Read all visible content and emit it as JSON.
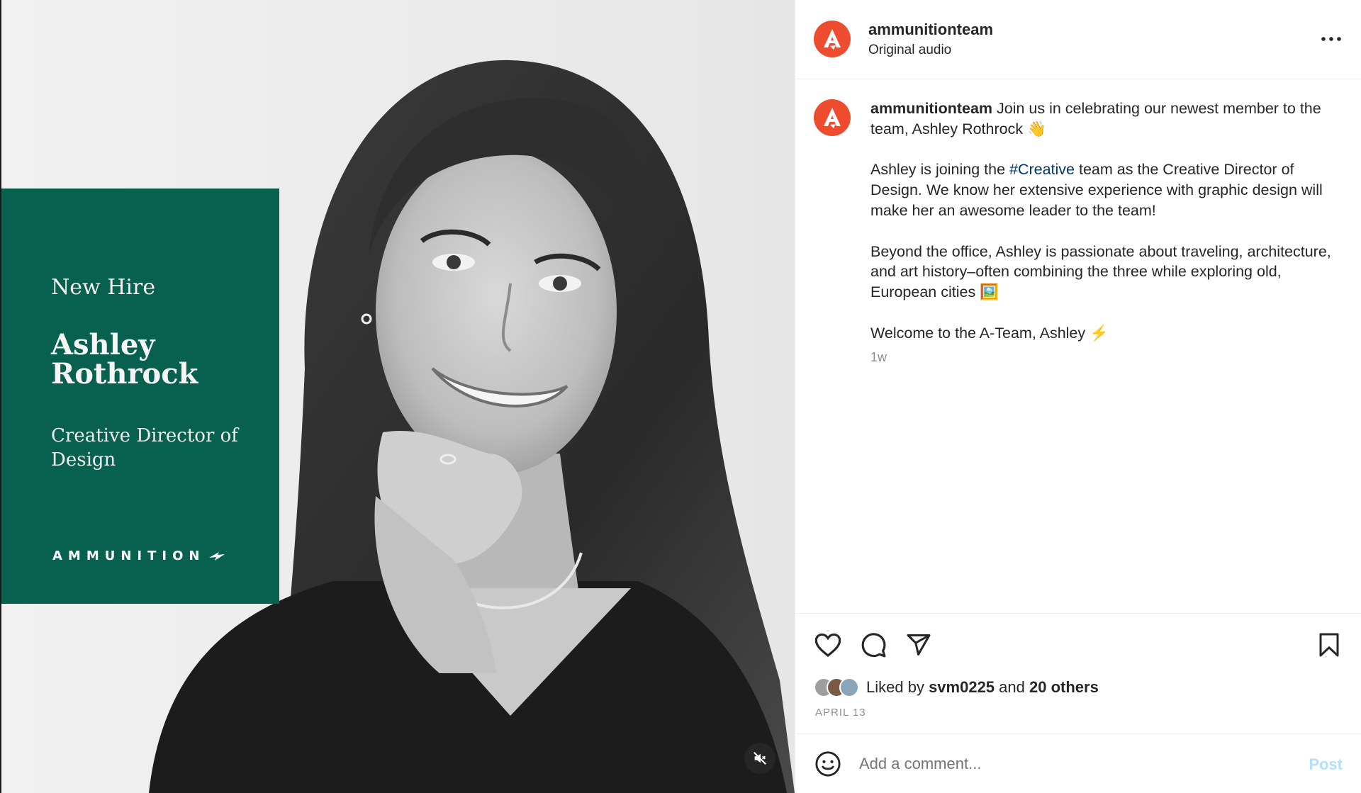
{
  "media": {
    "card": {
      "eyebrow": "New Hire",
      "name": "Ashley Rothrock",
      "role": "Creative Director of Design",
      "brand": "AMMUNITION"
    },
    "mute_icon": "speaker-muted-icon",
    "card_color": "#08614f"
  },
  "header": {
    "username": "ammunitionteam",
    "subtitle": "Original audio",
    "avatar_color": "#ee4c2e",
    "more_icon": "more-horizontal-icon"
  },
  "caption": {
    "username": "ammunitionteam",
    "line1_text": " Join us in celebrating our newest member to the team, Ashley Rothrock 👋",
    "p2_before": "Ashley is joining the ",
    "p2_hashtag": "#Creative",
    "p2_after": " team as the Creative Director of Design. We know her extensive experience with graphic design will make her an awesome leader to the team!",
    "p3": "Beyond the office, Ashley is passionate about traveling, architecture, and art history–often combining the three while exploring old, European cities 🖼️",
    "p4": "Welcome to the A-Team, Ashley ⚡",
    "time_ago": "1w"
  },
  "actions": {
    "icons": [
      "heart-icon",
      "comment-icon",
      "share-icon",
      "bookmark-icon"
    ],
    "liked_by_prefix": "Liked by ",
    "liked_by_user": "svm0225",
    "liked_by_and": " and ",
    "liked_by_others": "20 others",
    "date": "APRIL 13"
  },
  "comment": {
    "emoji_icon": "smiley-icon",
    "placeholder": "Add a comment...",
    "post_label": "Post",
    "post_color": "#b2dffc"
  }
}
